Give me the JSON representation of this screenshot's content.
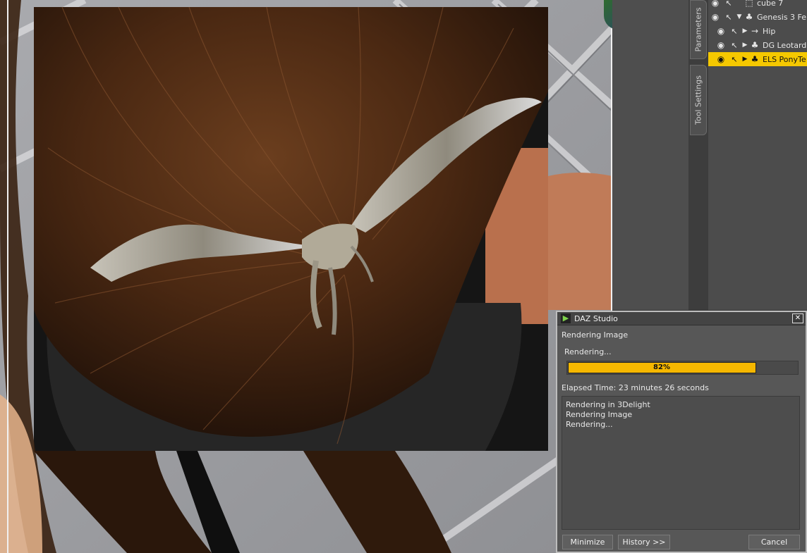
{
  "scene_panel": {
    "rows": [
      {
        "label": "cube 7",
        "eye": "eye-icon",
        "cursor": "cursor-icon",
        "icon": "cube-icon",
        "has_arrow": false,
        "selected": false
      },
      {
        "label": "Genesis 3 Fe",
        "eye": "eye-icon",
        "cursor": "cursor-icon",
        "icon": "figure-icon",
        "has_arrow": true,
        "expanded": true,
        "selected": false
      },
      {
        "label": "Hip",
        "eye": "eye-icon",
        "cursor": "cursor-icon",
        "icon": "bone-icon",
        "has_arrow": true,
        "selected": false
      },
      {
        "label": "DG Leotard",
        "eye": "eye-icon",
        "cursor": "cursor-icon",
        "icon": "figure-icon",
        "has_arrow": true,
        "selected": false
      },
      {
        "label": "ELS PonyTe",
        "eye": "eye-icon",
        "cursor": "cursor-icon",
        "icon": "figure-icon",
        "has_arrow": true,
        "selected": true
      }
    ]
  },
  "side_tabs": {
    "parameters": "Parameters",
    "tool_settings": "Tool Settings"
  },
  "dialog": {
    "title": "DAZ Studio",
    "close_symbol": "✕",
    "heading": "Rendering Image",
    "status": "Rendering...",
    "progress_percent": 82,
    "progress_label": "82%",
    "elapsed": "Elapsed Time:  23 minutes 26 seconds",
    "log": [
      "Rendering in 3Delight",
      "Rendering Image",
      "Rendering..."
    ],
    "buttons": {
      "minimize": "Minimize",
      "history": "History >>",
      "cancel": "Cancel"
    }
  },
  "colors": {
    "selection": "#f5c800",
    "progress": "#f5b700"
  }
}
